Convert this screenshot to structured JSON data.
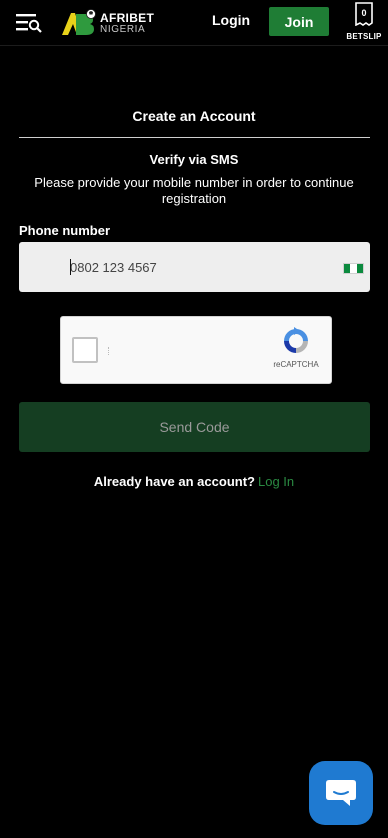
{
  "header": {
    "brand_line1": "AFRIBET",
    "brand_line2": "NIGERIA",
    "login_label": "Login",
    "join_label": "Join",
    "betslip_count": "0",
    "betslip_label": "BETSLIP"
  },
  "form": {
    "title": "Create an Account",
    "subtitle": "Verify via SMS",
    "description": "Please provide your mobile number in order to continue registration",
    "phone_label": "Phone number",
    "phone_placeholder": "0802 123 4567",
    "recaptcha_label": "reCAPTCHA",
    "send_code_label": "Send Code",
    "have_account_text": "Already have an account?",
    "login_link_label": "Log In"
  },
  "colors": {
    "brand_green": "#1f7d35",
    "send_button_bg": "#153e22",
    "link_green": "#2a8a42",
    "chat_blue": "#1f7ad1",
    "flag_green": "#0b8a3e"
  }
}
